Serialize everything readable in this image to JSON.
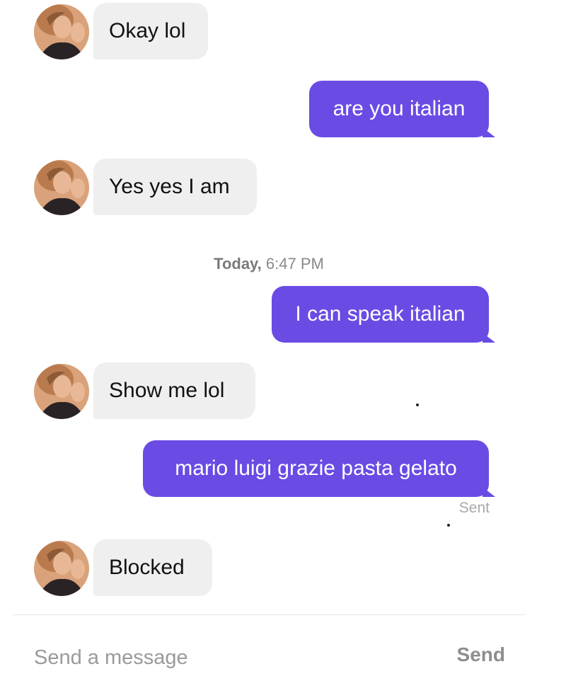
{
  "messages": [
    {
      "direction": "in",
      "text": "Okay lol"
    },
    {
      "direction": "out",
      "text": "are you italian"
    },
    {
      "direction": "in",
      "text": "Yes yes I am"
    },
    {
      "direction": "out",
      "text": "I can speak italian"
    },
    {
      "direction": "in",
      "text": "Show me lol"
    },
    {
      "direction": "out",
      "text": "mario luigi grazie pasta gelato"
    },
    {
      "direction": "in",
      "text": "Blocked"
    }
  ],
  "timestamp": {
    "day": "Today,",
    "time": "6:47 PM"
  },
  "delivery_status": "Sent",
  "composer": {
    "placeholder": "Send a message",
    "send_label": "Send"
  },
  "colors": {
    "outgoing_bubble": "#6a4be4",
    "incoming_bubble": "#efefef"
  },
  "icons": {
    "avatar": "profile-photo"
  }
}
